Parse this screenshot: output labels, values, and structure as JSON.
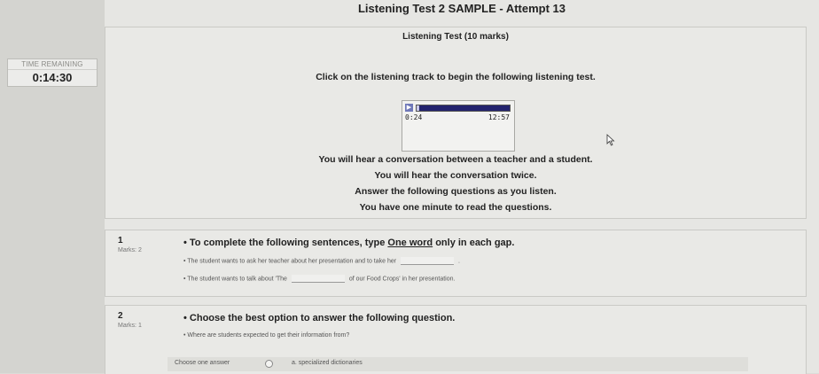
{
  "page": {
    "title": "Listening Test 2 SAMPLE - Attempt 13"
  },
  "timer": {
    "label": "TIME REMAINING",
    "value": "0:14:30"
  },
  "intro": {
    "subtitle": "Listening Test (10 marks)",
    "instruction": "Click on the listening track to begin the following listening test.",
    "player": {
      "current": "0:24",
      "total": "12:57",
      "progress": 0.03
    },
    "lines": [
      "You will hear a conversation between a teacher and a student.",
      "You will hear the conversation twice.",
      "Answer the following questions as you listen.",
      "You have one minute to read the questions."
    ]
  },
  "questions": [
    {
      "number": "1",
      "marks": "Marks: 2",
      "prompt_before": "• To complete the following sentences, type ",
      "prompt_emph": "One word",
      "prompt_after": " only in each gap.",
      "line1_before": "• The student wants to ask her teacher about her presentation and to take her",
      "line1_after": ".",
      "line2_before": "• The student wants to talk about 'The",
      "line2_after": "of our Food Crops' in her presentation."
    },
    {
      "number": "2",
      "marks": "Marks: 1",
      "prompt": "• Choose the best option to answer the following question.",
      "line1": "• Where are students expected to get their information from?",
      "choose_label": "Choose one answer",
      "option_a": "a. specialized dictionaries"
    }
  ]
}
